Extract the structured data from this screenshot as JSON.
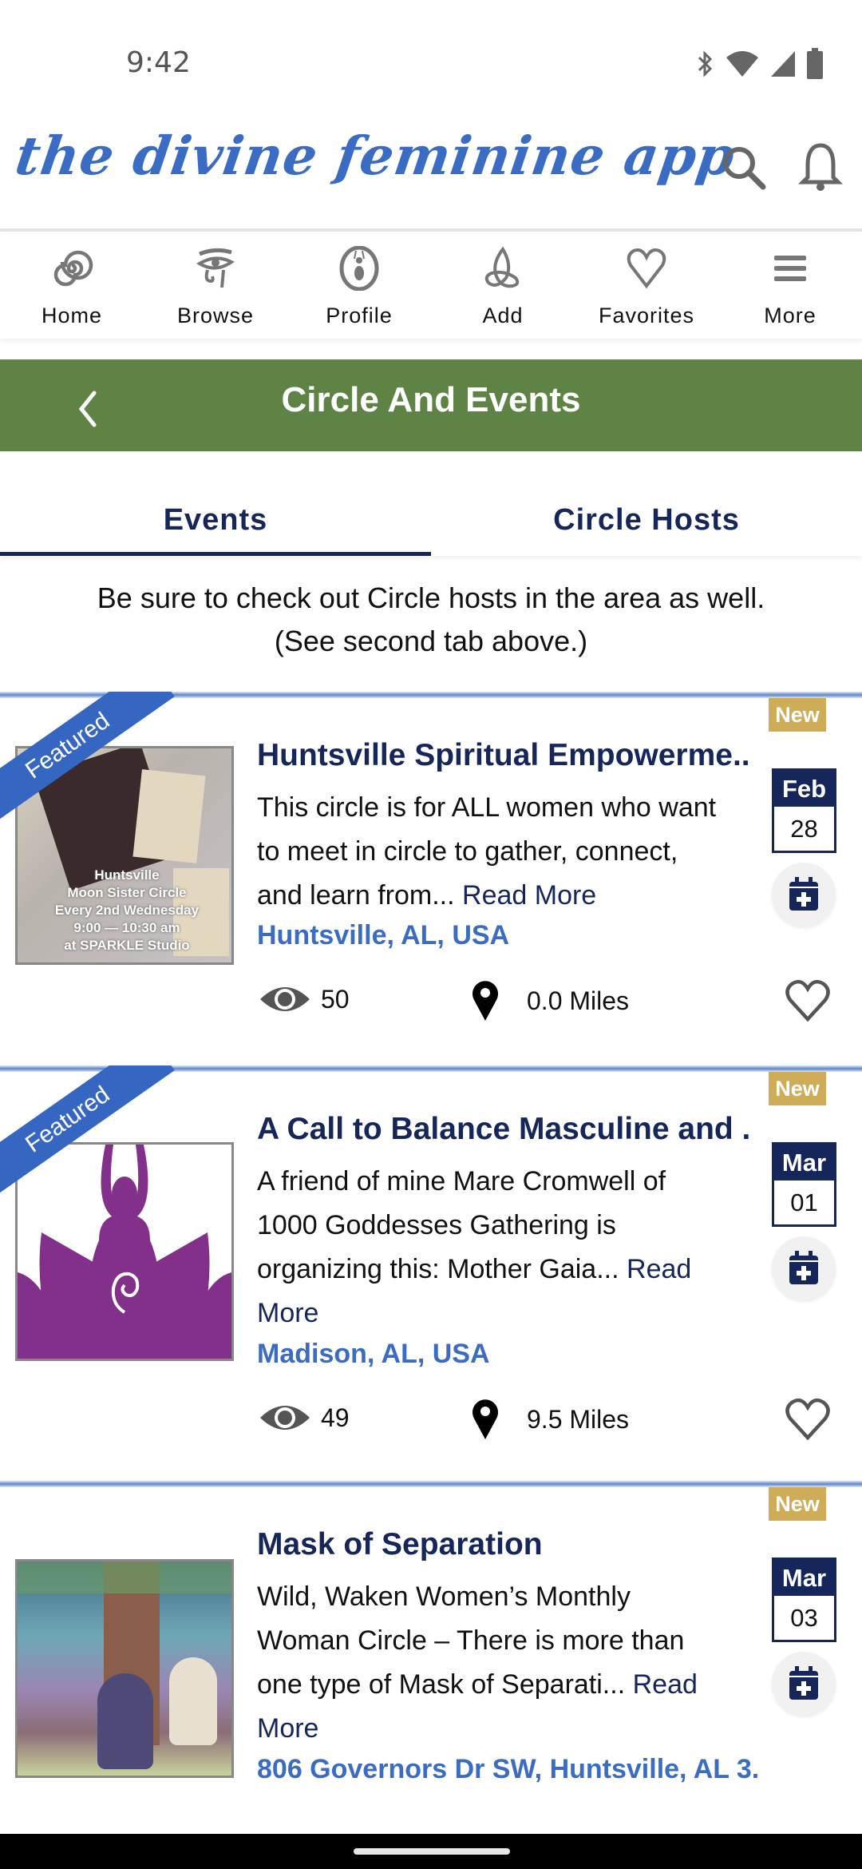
{
  "status_bar": {
    "time": "9:42",
    "icons": [
      "bluetooth-icon",
      "wifi-icon",
      "signal-icon",
      "battery-icon"
    ]
  },
  "app_header": {
    "logo_text": "the divine feminine app",
    "actions": [
      "search-icon",
      "bell-icon"
    ]
  },
  "nav": {
    "items": [
      {
        "label": "Home",
        "icon": "spiral-icon"
      },
      {
        "label": "Browse",
        "icon": "eye-of-horus-icon"
      },
      {
        "label": "Profile",
        "icon": "goddess-icon"
      },
      {
        "label": "Add",
        "icon": "triquetra-icon"
      },
      {
        "label": "Favorites",
        "icon": "heart-icon"
      },
      {
        "label": "More",
        "icon": "menu-icon"
      }
    ]
  },
  "page_header": {
    "title": "Circle And Events",
    "back_icon": "chevron-left-icon",
    "color": "#5e8345"
  },
  "tabs": [
    {
      "label": "Events",
      "active": true
    },
    {
      "label": "Circle Hosts",
      "active": false
    }
  ],
  "info_text": "Be sure to check out Circle hosts in the area as well. (See second tab above.)",
  "colors": {
    "primary_navy": "#15265a",
    "link_blue": "#3a6cc4",
    "featured_blue": "#3567c2",
    "new_gold": "#cfad58"
  },
  "events": [
    {
      "featured": true,
      "featured_label": "Featured",
      "new_label": "New",
      "title": "Huntsville Spiritual Empowerme...",
      "description": "This circle is for ALL women who want to meet in circle to gather, connect, and learn from...",
      "read_more": "Read More",
      "location": "Huntsville, AL, USA",
      "date_month": "Feb",
      "date_day": "28",
      "views": "50",
      "distance": "0.0 Miles",
      "image_text": [
        "Huntsville",
        "Moon Sister Circle",
        "Every 2nd Wednesday",
        "9:00 — 10:30 am",
        "at SPARKLE Studio"
      ]
    },
    {
      "featured": true,
      "featured_label": "Featured",
      "new_label": "New",
      "title": "A Call to Balance Masculine and ...",
      "description": "A friend of mine Mare Cromwell of 1000 Goddesses Gathering is organizing this: Mother Gaia...",
      "read_more": "Read More",
      "location": "Madison, AL, USA",
      "date_month": "Mar",
      "date_day": "01",
      "views": "49",
      "distance": "9.5 Miles"
    },
    {
      "featured": false,
      "new_label": "New",
      "title": "Mask of Separation",
      "description": "Wild, Waken Women’s Monthly Woman Circle – There is more than one type of Mask of Separati...",
      "read_more": "Read More",
      "location": "806 Governors Dr SW, Huntsville, AL 3...",
      "date_month": "Mar",
      "date_day": "03"
    }
  ]
}
